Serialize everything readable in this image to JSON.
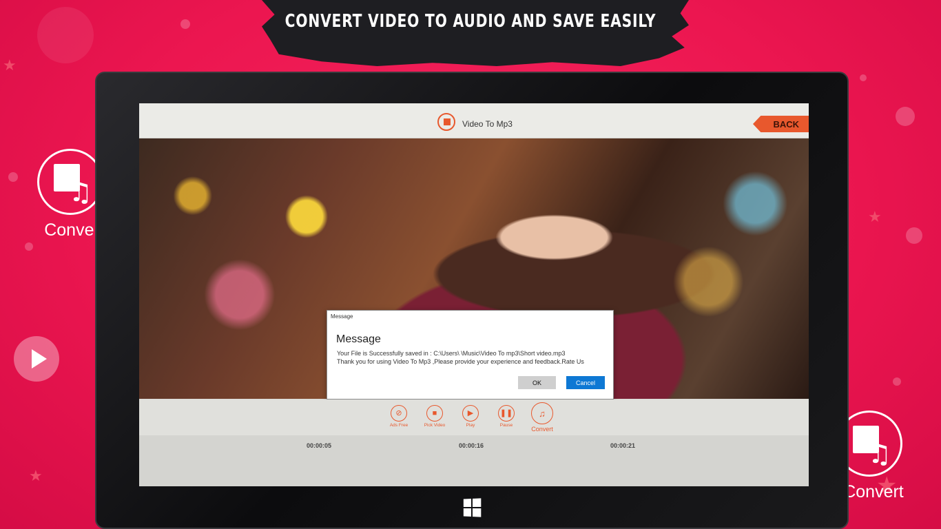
{
  "banner": {
    "headline": "CONVERT VIDEO TO AUDIO AND SAVE EASILY"
  },
  "side_badges": {
    "left_label": "Convert",
    "right_label": "Convert"
  },
  "app": {
    "title": "Video To Mp3",
    "back_label": "BACK"
  },
  "dialog": {
    "caption": "Message",
    "heading": "Message",
    "line1": "Your File is Successfully saved in : C:\\Users\\         \\Music\\Video To mp3\\Short video.mp3",
    "line2": "Thank you for using Video To Mp3 ,Please provide your experience and feedback.Rate Us",
    "ok_label": "OK",
    "cancel_label": "Cancel"
  },
  "toolbar": {
    "items": [
      {
        "label": "Ads Free",
        "icon": "ads-free-icon",
        "glyph": "⊘"
      },
      {
        "label": "Pick Video",
        "icon": "video-camera-icon",
        "glyph": "■"
      },
      {
        "label": "Play",
        "icon": "play-icon",
        "glyph": "▶"
      },
      {
        "label": "Pause",
        "icon": "pause-icon",
        "glyph": "❚❚"
      },
      {
        "label": "Convert",
        "icon": "convert-icon",
        "glyph": "♫"
      }
    ]
  },
  "timeline": {
    "times": [
      "00:00:05",
      "00:00:16",
      "00:00:21"
    ]
  },
  "colors": {
    "background": "#ec1650",
    "accent": "#e8582d",
    "dialog_primary": "#0e78d4"
  }
}
